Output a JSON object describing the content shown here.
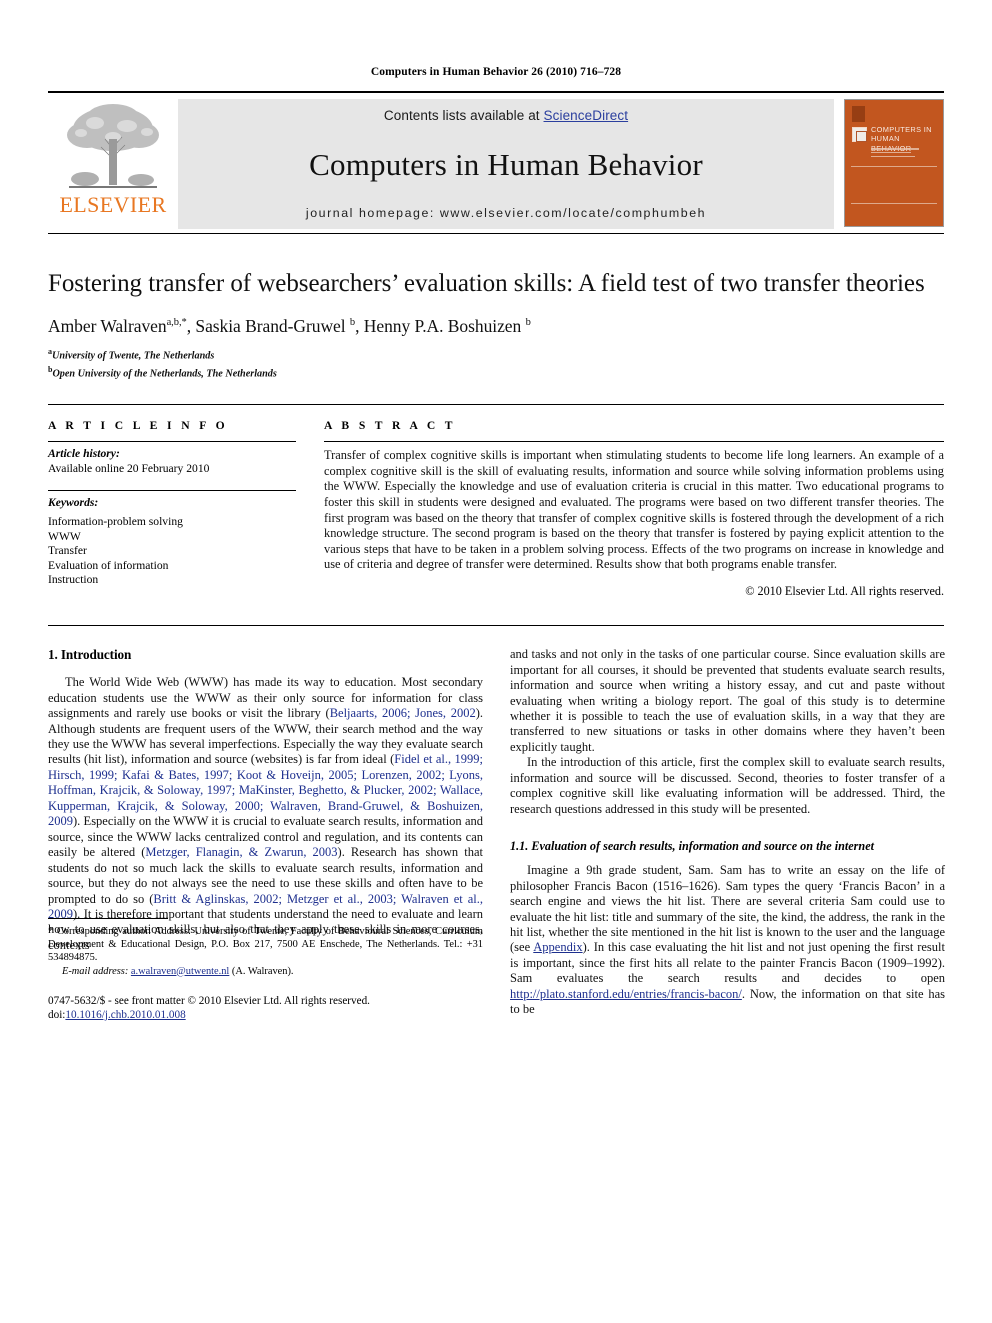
{
  "running_head": "Computers in Human Behavior 26 (2010) 716–728",
  "masthead": {
    "publisher_name": "ELSEVIER",
    "contents_prefix": "Contents lists available at ",
    "contents_link": "ScienceDirect",
    "journal_title": "Computers in Human Behavior",
    "homepage_line": "journal homepage: www.elsevier.com/locate/comphumbeh",
    "cover_title": "COMPUTERS IN HUMAN BEHAVIOR",
    "link_color": "#2b3f9e",
    "band_color": "#e6e6e6",
    "cover_color": "#C2561F",
    "elsevier_orange": "#E87722"
  },
  "article": {
    "title": "Fostering transfer of websearchers’ evaluation skills: A field test of two transfer theories",
    "authors": "Amber Walraven",
    "authors_sup_1": "a,b,*",
    "author2": ", Saskia Brand-Gruwel ",
    "author2_sup": "b",
    "author3": ", Henny P.A. Boshuizen ",
    "author3_sup": "b",
    "affiliation_a_sup": "a",
    "affiliation_a": "University of Twente, The Netherlands",
    "affiliation_b_sup": "b",
    "affiliation_b": "Open University of the Netherlands, The Netherlands"
  },
  "article_info": {
    "heading": "A R T I C L E  I N F O",
    "history_label": "Article history:",
    "history_value": "Available online 20 February 2010",
    "keywords_label": "Keywords:",
    "keywords": [
      "Information-problem solving",
      "WWW",
      "Transfer",
      "Evaluation of information",
      "Instruction"
    ]
  },
  "abstract": {
    "heading": "A B S T R A C T",
    "body": "Transfer of complex cognitive skills is important when stimulating students to become life long learners. An example of a complex cognitive skill is the skill of evaluating results, information and source while solving information problems using the WWW. Especially the knowledge and use of evaluation criteria is crucial in this matter. Two educational programs to foster this skill in students were designed and evaluated. The programs were based on two different transfer theories. The first program was based on the theory that transfer of complex cognitive skills is fostered through the development of a rich knowledge structure. The second program is based on the theory that transfer is fostered by paying explicit attention to the various steps that have to be taken in a problem solving process. Effects of the two programs on increase in knowledge and use of criteria and degree of transfer were determined. Results show that both programs enable transfer.",
    "copyright": "© 2010 Elsevier Ltd. All rights reserved."
  },
  "body": {
    "section1_title": "1. Introduction",
    "left_p1_a": "The World Wide Web (WWW) has made its way to education. Most secondary education students use the WWW as their only source for information for class assignments and rarely use books or visit the library (",
    "left_p1_cite1": "Beljaarts, 2006; Jones, 2002",
    "left_p1_b": "). Although students are frequent users of the WWW, their search method and the way they use the WWW has several imperfections. Especially the way they evaluate search results (hit list), information and source (websites) is far from ideal (",
    "left_p1_cite2": "Fidel et al., 1999; Hirsch, 1999; Kafai & Bates, 1997; Koot & Hoveijn, 2005; Lorenzen, 2002; Lyons, Hoffman, Krajcik, & Soloway, 1997; MaKinster, Beghetto, & Plucker, 2002; Wallace, Kupperman, Krajcik, & Soloway, 2000; Walraven, Brand-Gruwel, & Boshuizen, 2009",
    "left_p1_c": "). Especially on the WWW it is crucial to evaluate search results, information and source, since the WWW lacks centralized control and regulation, and its contents can easily be altered (",
    "left_p1_cite3": "Metzger, Flanagin, & Zwarun, 2003",
    "left_p1_d": "). Research has shown that students do not so much lack the skills to evaluate search results, information and source, but they do not always see the need to use these skills and often have to be prompted to do so (",
    "left_p1_cite4": "Britt & Aglinskas, 2002; Metzger et al., 2003; Walraven et al., 2009",
    "left_p1_e": "). It is therefore important that students understand the need to evaluate and learn how to use evaluation skills, but also that they apply these skills in more courses, contexts",
    "right_p1_cont": "and tasks and not only in the tasks of one particular course. Since evaluation skills are important for all courses, it should be prevented that students evaluate search results, information and source when writing a history essay, and cut and paste without evaluating when writing a biology report. The goal of this study is to determine whether it is possible to teach the use of evaluation skills, in a way that they are transferred to new situations or tasks in other domains where they haven’t been explicitly taught.",
    "right_p2": "In the introduction of this article, first the complex skill to evaluate search results, information and source will be discussed. Second, theories to foster transfer of a complex cognitive skill like evaluating information will be addressed. Third, the research questions addressed in this study will be presented.",
    "subsection_1_1": "1.1. Evaluation of search results, information and source on the internet",
    "right_p3_a": "Imagine a 9th grade student, Sam. Sam has to write an essay on the life of philosopher Francis Bacon (1516–1626). Sam types the query ‘Francis Bacon’ in a search engine and views the hit list. There are several criteria Sam could use to evaluate the hit list: title and summary of the site, the kind, the address, the rank in the hit list, whether the site mentioned in the hit list is known to the user and the language (see ",
    "right_p3_link1": "Appendix",
    "right_p3_b": "). In this case evaluating the hit list and not just opening the first result is important, since the first hits all relate to the painter Francis Bacon (1909–1992). Sam evaluates the search results and decides to open ",
    "right_p3_link2": "http://plato.stanford.edu/entries/francis-bacon/",
    "right_p3_c": ". Now, the information on that site has to be"
  },
  "footnotes": {
    "star": "*",
    "corresponding": " Corresponding author. Address: University of Twente, Faculty of Behavioural Sciences, Curriculum Development & Educational Design, P.O. Box 217, 7500 AE Enschede, The Netherlands. Tel.: +31 534894875.",
    "email_label": "E-mail address:",
    "email_value": "a.walraven@utwente.nl",
    "email_suffix": " (A. Walraven).",
    "issn_line": "0747-5632/$ - see front matter © 2010 Elsevier Ltd. All rights reserved.",
    "doi_label": "doi:",
    "doi_value": "10.1016/j.chb.2010.01.008"
  }
}
